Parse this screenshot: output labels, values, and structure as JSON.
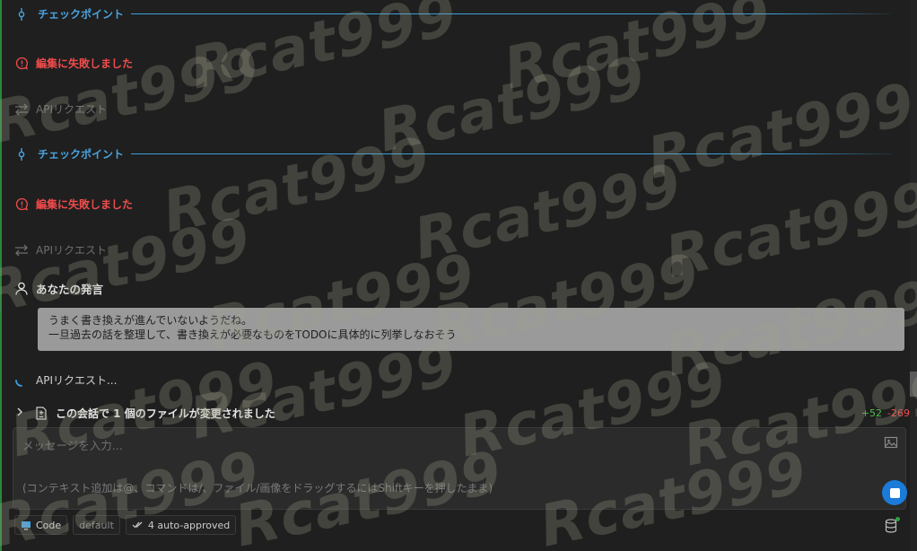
{
  "timeline": {
    "checkpoint_1": "チェックポイント",
    "error_1": "編集に失敗しました",
    "api_1": "APIリクエスト",
    "checkpoint_2": "チェックポイント",
    "error_2": "編集に失敗しました",
    "api_2": "APIリクエスト",
    "speaker": "あなたの発言",
    "user_message_line1": "うまく書き換えが進んでいないようだね。",
    "user_message_line2": "一旦過去の話を整理して、書き換えが必要なものをTODOに具体的に列挙しなおそう",
    "api_loading": "APIリクエスト..."
  },
  "changed_files": {
    "label": "この会話で 1 個のファイルが変更されました",
    "added": "+52",
    "removed": "-269"
  },
  "composer": {
    "placeholder": "メッセージを入力...",
    "hint": "(コンテキスト追加は@、コマンドは/、ファイル/画像をドラッグするにはShiftキーを押したまま)"
  },
  "bottom_bar": {
    "mode": "Code",
    "model": "default",
    "auto_approved": "4 auto-approved"
  },
  "watermark_text": "Rcat999",
  "colors": {
    "checkpoint": "#4aa3df",
    "error": "#f14c4c",
    "added": "#4bbf4b",
    "removed": "#f14c4c",
    "send_button": "#1a7bd9"
  },
  "icons": {
    "checkpoint": "git-commit-icon",
    "error": "error-bubble-icon",
    "api": "arrows-swap-icon",
    "speaker": "person-icon",
    "loading": "spinner-icon",
    "changed_files": "file-diff-icon",
    "image": "image-icon",
    "send": "stop-icon",
    "db": "database-icon"
  }
}
